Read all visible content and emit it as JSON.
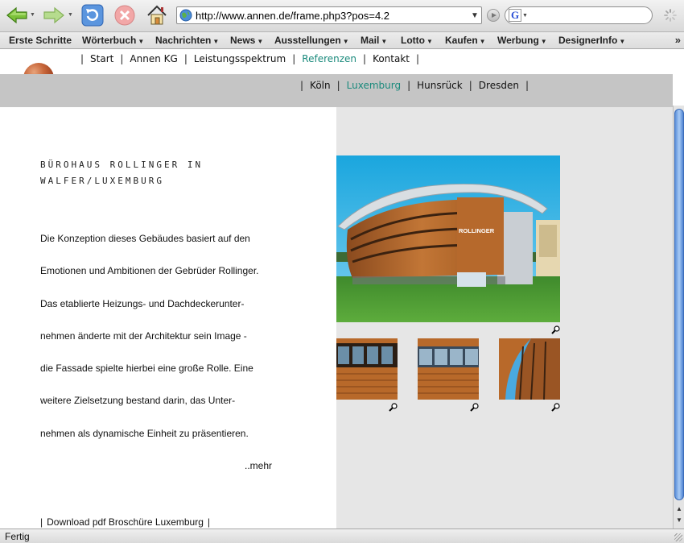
{
  "browser": {
    "url": "http://www.annen.de/frame.php3?pos=4.2",
    "search_engine_icon": "G",
    "status": "Fertig",
    "toolbar_icons": [
      "back-arrow-icon",
      "forward-arrow-icon",
      "reload-icon",
      "stop-icon",
      "home-icon",
      "globe-icon",
      "go-icon",
      "throbber-icon"
    ]
  },
  "bookmarks": [
    {
      "label": "Erste Schritte",
      "dropdown": false
    },
    {
      "label": "Wörterbuch",
      "dropdown": true
    },
    {
      "label": "Nachrichten",
      "dropdown": true
    },
    {
      "label": "News",
      "dropdown": true
    },
    {
      "label": "Ausstellungen",
      "dropdown": true
    },
    {
      "label": "Mail",
      "dropdown": true
    },
    {
      "label": "Lotto",
      "dropdown": true
    },
    {
      "label": "Kaufen",
      "dropdown": true
    },
    {
      "label": "Werbung",
      "dropdown": true
    },
    {
      "label": "DesignerInfo",
      "dropdown": true
    }
  ],
  "bookmarks_overflow": "»",
  "site": {
    "top_nav": [
      {
        "label": "Start",
        "active": false
      },
      {
        "label": "Annen KG",
        "active": false
      },
      {
        "label": "Leistungsspektrum",
        "active": false
      },
      {
        "label": "Referenzen",
        "active": true
      },
      {
        "label": "Kontakt",
        "active": false
      }
    ],
    "sub_nav": [
      {
        "label": "Köln",
        "active": false
      },
      {
        "label": "Luxemburg",
        "active": true
      },
      {
        "label": "Hunsrück",
        "active": false
      },
      {
        "label": "Dresden",
        "active": false
      }
    ],
    "separator": "|",
    "active_color": "#1a8a7c",
    "headline_lines": [
      "BÜROHAUS ROLLINGER IN",
      "WALFER/LUXEMBURG"
    ],
    "body_lines": [
      "Die Konzeption dieses Gebäudes basiert auf den",
      "Emotionen und Ambitionen der Gebrüder Rollinger.",
      "Das etablierte Heizungs- und Dachdeckerunter-",
      "nehmen änderte mit der Architektur sein Image -",
      "die Fassade spielte hierbei eine große Rolle. Eine",
      "weitere Zielsetzung bestand darin, das Unter-",
      "nehmen als dynamische Einheit zu präsentieren."
    ],
    "more_link": "..mehr",
    "download_link": "Download pdf Broschüre Luxemburg",
    "building_sign": "ROLLINGER",
    "zoom_icon": "magnifier-icon"
  }
}
